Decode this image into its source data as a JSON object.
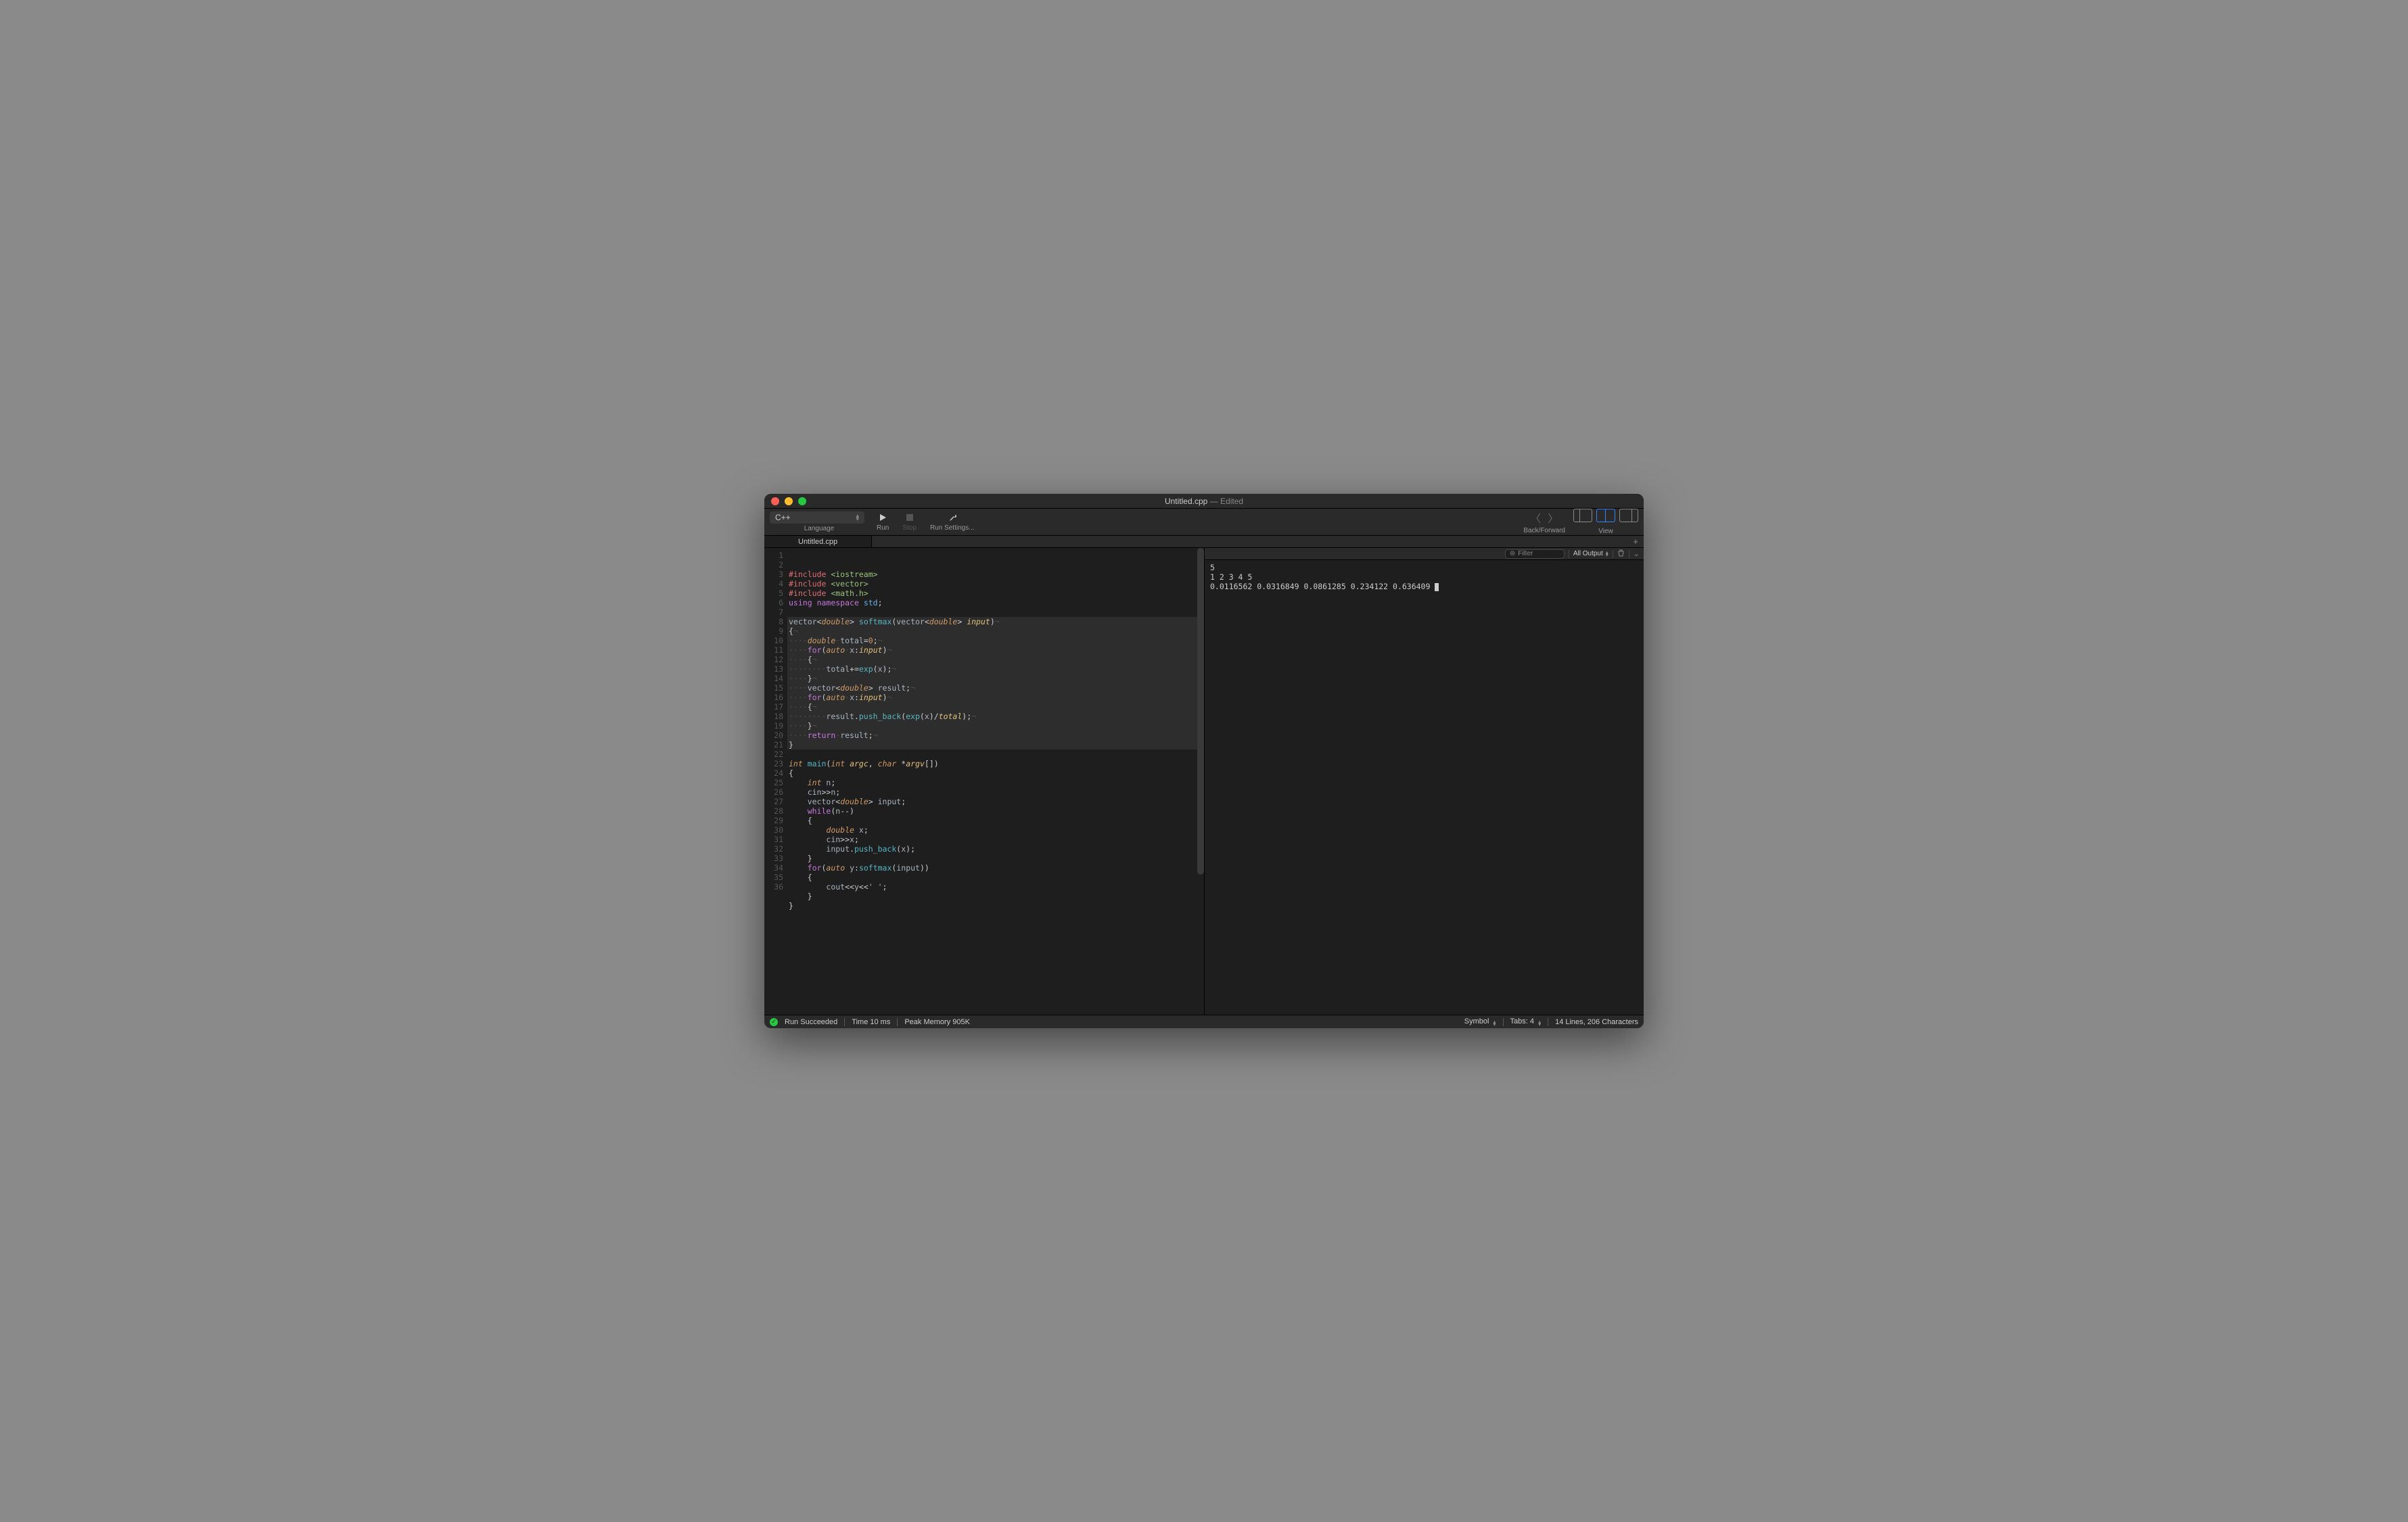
{
  "window": {
    "title": "Untitled.cpp",
    "edited_suffix": "Edited"
  },
  "toolbar": {
    "language": {
      "label": "Language",
      "value": "C++"
    },
    "run": "Run",
    "stop": "Stop",
    "run_settings": "Run Settings...",
    "back_forward": "Back/Forward",
    "view": "View"
  },
  "tab": {
    "name": "Untitled.cpp"
  },
  "code_lines": [
    {
      "hl": false,
      "html": "<span class='pre'>#include</span> <span class='str'>&lt;iostream&gt;</span>"
    },
    {
      "hl": false,
      "html": "<span class='pre'>#include</span> <span class='str'>&lt;vector&gt;</span>"
    },
    {
      "hl": false,
      "html": "<span class='pre'>#include</span> <span class='str'>&lt;math.h&gt;</span>"
    },
    {
      "hl": false,
      "html": "<span class='kw'>using</span> <span class='kw'>namespace</span> <span class='type'>std</span>;"
    },
    {
      "hl": false,
      "html": ""
    },
    {
      "hl": true,
      "html": "<span class='id'>vector</span>&lt;<span class='kw2'>double</span>&gt; <span class='fn'>softmax</span>(<span class='id'>vector</span>&lt;<span class='kw2'>double</span>&gt; <span class='param'>input</span>)<span class='dim'>¬</span>"
    },
    {
      "hl": true,
      "html": "{<span class='dim'>¬</span>"
    },
    {
      "hl": true,
      "html": "<span class='dim'>····</span><span class='kw2'>double</span><span class='dim'>·</span><span class='id'>total</span>=<span class='num'>0</span>;<span class='dim'>¬</span>"
    },
    {
      "hl": true,
      "html": "<span class='dim'>····</span><span class='kw'>for</span>(<span class='kw2'>auto</span><span class='dim'>·</span><span class='id'>x</span>:<span class='param'>input</span>)<span class='dim'>¬</span>"
    },
    {
      "hl": true,
      "html": "<span class='dim'>····</span>{<span class='dim'>¬</span>"
    },
    {
      "hl": true,
      "html": "<span class='dim'>········</span><span class='id'>total</span>+=<span class='fn'>exp</span>(<span class='id'>x</span>);<span class='dim'>¬</span>"
    },
    {
      "hl": true,
      "html": "<span class='dim'>····</span>}<span class='dim'>¬</span>"
    },
    {
      "hl": true,
      "html": "<span class='dim'>····</span><span class='id'>vector</span>&lt;<span class='kw2'>double</span>&gt; <span class='id'>result</span>;<span class='dim'>¬</span>"
    },
    {
      "hl": true,
      "html": "<span class='dim'>····</span><span class='kw'>for</span>(<span class='kw2'>auto</span><span class='dim'>·</span><span class='id'>x</span>:<span class='param'>input</span>)<span class='dim'>¬</span>"
    },
    {
      "hl": true,
      "html": "<span class='dim'>····</span>{<span class='dim'>¬</span>"
    },
    {
      "hl": true,
      "html": "<span class='dim'>········</span><span class='id'>result</span>.<span class='fn'>push_back</span>(<span class='fn'>exp</span>(<span class='id'>x</span>)/<span class='param'>total</span>);<span class='dim'>¬</span>"
    },
    {
      "hl": true,
      "html": "<span class='dim'>····</span>}<span class='dim'>¬</span>"
    },
    {
      "hl": true,
      "html": "<span class='dim'>····</span><span class='kw'>return</span><span class='dim'>·</span><span class='id'>result</span>;<span class='dim'>¬</span>"
    },
    {
      "hl": true,
      "html": "}"
    },
    {
      "hl": false,
      "html": ""
    },
    {
      "hl": false,
      "html": "<span class='kw2'>int</span> <span class='fn'>main</span>(<span class='kw2'>int</span> <span class='param'>argc</span>, <span class='kw2'>char</span> *<span class='param'>argv</span>[])"
    },
    {
      "hl": false,
      "html": "{"
    },
    {
      "hl": false,
      "html": "    <span class='kw2'>int</span> <span class='id'>n</span>;"
    },
    {
      "hl": false,
      "html": "    <span class='id'>cin</span>&gt;&gt;<span class='id'>n</span>;"
    },
    {
      "hl": false,
      "html": "    <span class='id'>vector</span>&lt;<span class='kw2'>double</span>&gt; <span class='id'>input</span>;"
    },
    {
      "hl": false,
      "html": "    <span class='kw'>while</span>(<span class='id'>n</span>--)"
    },
    {
      "hl": false,
      "html": "    {"
    },
    {
      "hl": false,
      "html": "        <span class='kw2'>double</span> <span class='id'>x</span>;"
    },
    {
      "hl": false,
      "html": "        <span class='id'>cin</span>&gt;&gt;<span class='id'>x</span>;"
    },
    {
      "hl": false,
      "html": "        <span class='id'>input</span>.<span class='fn'>push_back</span>(<span class='id'>x</span>);"
    },
    {
      "hl": false,
      "html": "    }"
    },
    {
      "hl": false,
      "html": "    <span class='kw'>for</span>(<span class='kw2'>auto</span> <span class='id'>y</span>:<span class='fn'>softmax</span>(<span class='id'>input</span>))"
    },
    {
      "hl": false,
      "html": "    {"
    },
    {
      "hl": false,
      "html": "        <span class='id'>cout</span>&lt;&lt;<span class='id'>y</span>&lt;&lt;<span class='str'>' '</span>;"
    },
    {
      "hl": false,
      "html": "    }"
    },
    {
      "hl": false,
      "html": "}"
    }
  ],
  "output": {
    "filter_placeholder": "Filter",
    "select_label": "All Output",
    "lines": [
      "5",
      "1 2 3 4 5",
      "0.0116562 0.0316849 0.0861285 0.234122 0.636409 "
    ]
  },
  "status": {
    "run": "Run Succeeded",
    "time": "Time 10 ms",
    "memory": "Peak Memory 905K",
    "symbol": "Symbol",
    "tabs": "Tabs: 4",
    "lines": "14 Lines, 206 Characters"
  }
}
